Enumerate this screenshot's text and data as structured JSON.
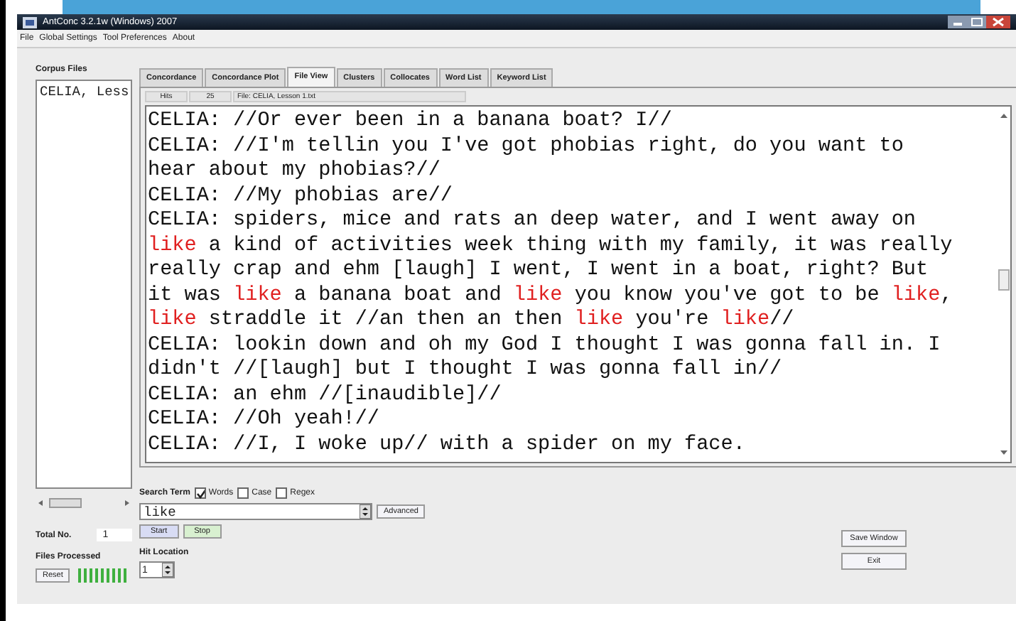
{
  "window": {
    "title": "AntConc 3.2.1w (Windows) 2007"
  },
  "menu": [
    "File",
    "Global Settings",
    "Tool Preferences",
    "About"
  ],
  "corpus_files": {
    "label": "Corpus Files",
    "items": [
      {
        "name": "CELIA, Less",
        "selected": false
      }
    ]
  },
  "totals": {
    "label": "Total No.",
    "value": "1"
  },
  "files_processed": {
    "label": "Files Processed",
    "level": 1,
    "reset": "Reset"
  },
  "tabs": [
    {
      "label": "Concordance",
      "selected": false
    },
    {
      "label": "Concordance Plot",
      "selected": false
    },
    {
      "label": "File View",
      "selected": true
    },
    {
      "label": "Clusters",
      "selected": false
    },
    {
      "label": "Collocates",
      "selected": false
    },
    {
      "label": "Word List",
      "selected": false
    },
    {
      "label": "Keyword List",
      "selected": false
    }
  ],
  "info_bar": {
    "hits_label": "Hits",
    "hits": "25",
    "file": "File: CELIA, Lesson 1.txt"
  },
  "lines": [
    [
      {
        "text": "CELIA: //Or ever been in a banana boat? I//",
        "hit": false
      }
    ],
    [
      {
        "text": "CELIA: //I'm tellin you I've got phobias right, do you want to",
        "hit": false
      }
    ],
    [
      {
        "text": "hear about my phobias?//",
        "hit": false
      }
    ],
    [
      {
        "text": "CELIA: //My phobias are//",
        "hit": false
      }
    ],
    [
      {
        "text": "CELIA: spiders, mice and rats an deep water, and I went away on",
        "hit": false
      }
    ],
    [
      {
        "text": "like",
        "hit": true
      },
      {
        "text": " a kind of activities week thing with my family, it was really",
        "hit": false
      }
    ],
    [
      {
        "text": "really crap and ehm [laugh] I went, I went in a boat, right? But",
        "hit": false
      }
    ],
    [
      {
        "text": "it was ",
        "hit": false
      },
      {
        "text": "like",
        "hit": true
      },
      {
        "text": " a banana boat and ",
        "hit": false
      },
      {
        "text": "like",
        "hit": true
      },
      {
        "text": " you know you've got to be ",
        "hit": false
      },
      {
        "text": "like",
        "hit": true
      },
      {
        "text": ",",
        "hit": false
      }
    ],
    [
      {
        "text": "like",
        "hit": true
      },
      {
        "text": " straddle it //an then an then ",
        "hit": false
      },
      {
        "text": "like",
        "hit": true
      },
      {
        "text": " you're ",
        "hit": false
      },
      {
        "text": "like",
        "hit": true
      },
      {
        "text": "//",
        "hit": false
      }
    ],
    [
      {
        "text": "CELIA: lookin down and oh my God I thought I was gonna fall in. I",
        "hit": false
      }
    ],
    [
      {
        "text": "didn't //[laugh] but I thought I was gonna fall in//",
        "hit": false
      }
    ],
    [
      {
        "text": "CELIA: an ehm //[inaudible]//",
        "hit": false
      }
    ],
    [
      {
        "text": "CELIA: //Oh yeah!//",
        "hit": false
      }
    ],
    [
      {
        "text": "CELIA: //I, I woke up// with a spider on my face.",
        "hit": false
      }
    ]
  ],
  "search": {
    "label": "Search Term",
    "options": [
      {
        "label": "Words",
        "checked": true
      },
      {
        "label": "Case",
        "checked": false
      },
      {
        "label": "Regex",
        "checked": false
      }
    ],
    "value": "like",
    "advanced": "Advanced",
    "start": "Start",
    "stop": "Stop"
  },
  "hit_location": {
    "label": "Hit Location",
    "value": "1"
  },
  "buttons": [
    "Save Window",
    "Exit"
  ]
}
